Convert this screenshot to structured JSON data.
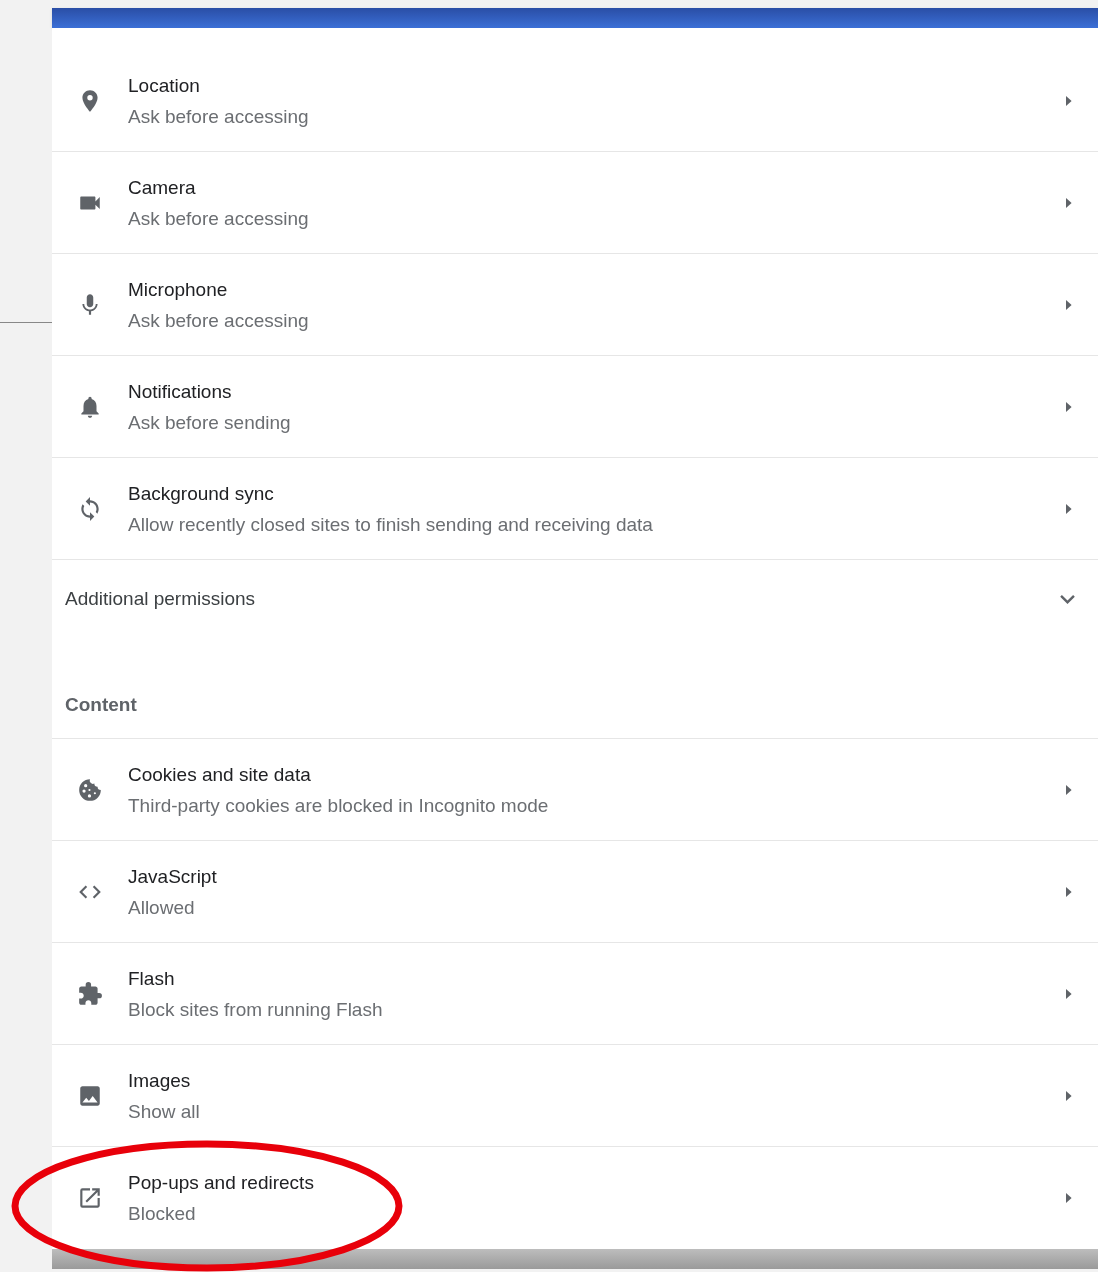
{
  "permissions": [
    {
      "kind": "location",
      "title": "Location",
      "subtitle": "Ask before accessing"
    },
    {
      "kind": "camera",
      "title": "Camera",
      "subtitle": "Ask before accessing"
    },
    {
      "kind": "microphone",
      "title": "Microphone",
      "subtitle": "Ask before accessing"
    },
    {
      "kind": "bell",
      "title": "Notifications",
      "subtitle": "Ask before sending"
    },
    {
      "kind": "sync",
      "title": "Background sync",
      "subtitle": "Allow recently closed sites to finish sending and receiving data"
    }
  ],
  "additional_permissions": {
    "label": "Additional permissions",
    "expanded": false
  },
  "content": {
    "heading": "Content",
    "items": [
      {
        "kind": "cookie",
        "title": "Cookies and site data",
        "subtitle": "Third-party cookies are blocked in Incognito mode"
      },
      {
        "kind": "code",
        "title": "JavaScript",
        "subtitle": "Allowed"
      },
      {
        "kind": "puzzle",
        "title": "Flash",
        "subtitle": "Block sites from running Flash"
      },
      {
        "kind": "image",
        "title": "Images",
        "subtitle": "Show all"
      },
      {
        "kind": "open-in-new",
        "title": "Pop-ups and redirects",
        "subtitle": "Blocked"
      }
    ]
  },
  "annotation": {
    "kind": "ellipse"
  }
}
